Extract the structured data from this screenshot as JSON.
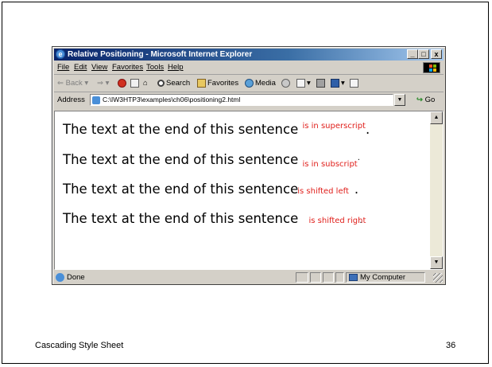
{
  "slide": {
    "footer_left": "Cascading Style Sheet",
    "footer_right": "36"
  },
  "window": {
    "title": "Relative Positioning - Microsoft Internet Explorer",
    "controls": {
      "minimize": "_",
      "maximize": "□",
      "close": "x"
    }
  },
  "menu": [
    "File",
    "Edit",
    "View",
    "Favorites",
    "Tools",
    "Help"
  ],
  "toolbar": {
    "back": "Back",
    "search": "Search",
    "favorites": "Favorites",
    "media": "Media"
  },
  "address": {
    "label": "Address",
    "value": "C:\\IW3HTP3\\examples\\ch06\\positioning2.html",
    "go": "Go"
  },
  "content": {
    "lines": [
      {
        "text": "The text at the end of this sentence ",
        "span": "is in superscript",
        "tail": "."
      },
      {
        "text": "The text at the end of this sentence ",
        "span": "is in subscript",
        "tail": "."
      },
      {
        "text": "The text at the end of this sentence",
        "span": "is shifted left",
        "tail": "."
      },
      {
        "text": "The text at the end of this sentence ",
        "span": "is shifted right",
        "tail": "."
      }
    ]
  },
  "status": {
    "text": "Done",
    "zone": "My Computer"
  },
  "colors": {
    "title_gradient_start": "#0a246a",
    "title_gradient_end": "#a6caf0",
    "span_red": "#e0201c",
    "chrome": "#d4d0c8"
  }
}
